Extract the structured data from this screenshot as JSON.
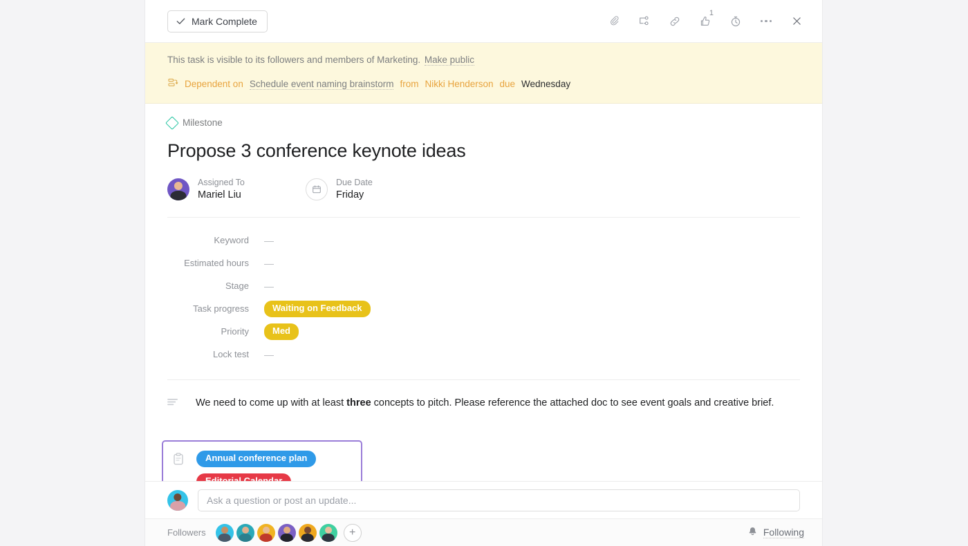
{
  "window": {
    "background": "#f4f4f6",
    "panel_background": "#ffffff"
  },
  "topbar": {
    "mark_complete_label": "Mark Complete",
    "icons": [
      {
        "name": "attachment-icon",
        "title": "Attach file"
      },
      {
        "name": "subtask-icon",
        "title": "Add subtask"
      },
      {
        "name": "link-icon",
        "title": "Copy task link"
      },
      {
        "name": "like-icon",
        "title": "Like",
        "badge": "1"
      },
      {
        "name": "timer-icon",
        "title": "Track time"
      },
      {
        "name": "more-icon",
        "title": "More actions"
      },
      {
        "name": "close-icon",
        "title": "Close"
      }
    ]
  },
  "banner": {
    "background": "#fdf8dd",
    "visibility_text": "This task is visible to its followers and members of Marketing.",
    "make_public_label": "Make public",
    "dependency": {
      "prefix": "Dependent on",
      "task": "Schedule event naming brainstorm",
      "from_label": "from",
      "person": "Nikki Henderson",
      "due_label": "due",
      "due_value": "Wednesday",
      "accent_color": "#e8a33d"
    }
  },
  "task": {
    "milestone_label": "Milestone",
    "milestone_color": "#23c4a0",
    "title": "Propose 3 conference keynote ideas",
    "assignee": {
      "label": "Assigned To",
      "value": "Mariel Liu",
      "avatar_color": "#6f56c4"
    },
    "due_date": {
      "label": "Due Date",
      "value": "Friday"
    }
  },
  "fields": [
    {
      "label": "Keyword",
      "value": "—",
      "type": "empty"
    },
    {
      "label": "Estimated hours",
      "value": "—",
      "type": "empty"
    },
    {
      "label": "Stage",
      "value": "—",
      "type": "empty"
    },
    {
      "label": "Task progress",
      "value": "Waiting on Feedback",
      "type": "pill",
      "color": "#e8c21a"
    },
    {
      "label": "Priority",
      "value": "Med",
      "type": "pill",
      "color": "#e8c21a"
    },
    {
      "label": "Lock test",
      "value": "—",
      "type": "empty"
    }
  ],
  "description": {
    "part1": "We need to come up with at least ",
    "bold": "three",
    "part2": " concepts to pitch. Please reference the attached doc to see event goals and creative brief."
  },
  "projects": {
    "selection_border_color": "#9a7dd8",
    "items": [
      {
        "label": "Annual conference plan",
        "color": "#2f9ae8"
      },
      {
        "label": "Editorial Calendar",
        "color": "#e63946"
      }
    ]
  },
  "composer": {
    "placeholder": "Ask a question or post an update...",
    "value": "",
    "avatar_color": "#34c3e8"
  },
  "followers": {
    "label": "Followers",
    "avatars": [
      {
        "name": "follower-1",
        "color": "#34c3e8"
      },
      {
        "name": "follower-2",
        "color": "#2aa9b8"
      },
      {
        "name": "follower-3",
        "color": "#f0b323"
      },
      {
        "name": "follower-4",
        "color": "#7a5fc4"
      },
      {
        "name": "follower-5",
        "color": "#efa81e"
      },
      {
        "name": "follower-6",
        "color": "#3fd0a0"
      }
    ],
    "add_label": "+",
    "following_label": "Following"
  }
}
